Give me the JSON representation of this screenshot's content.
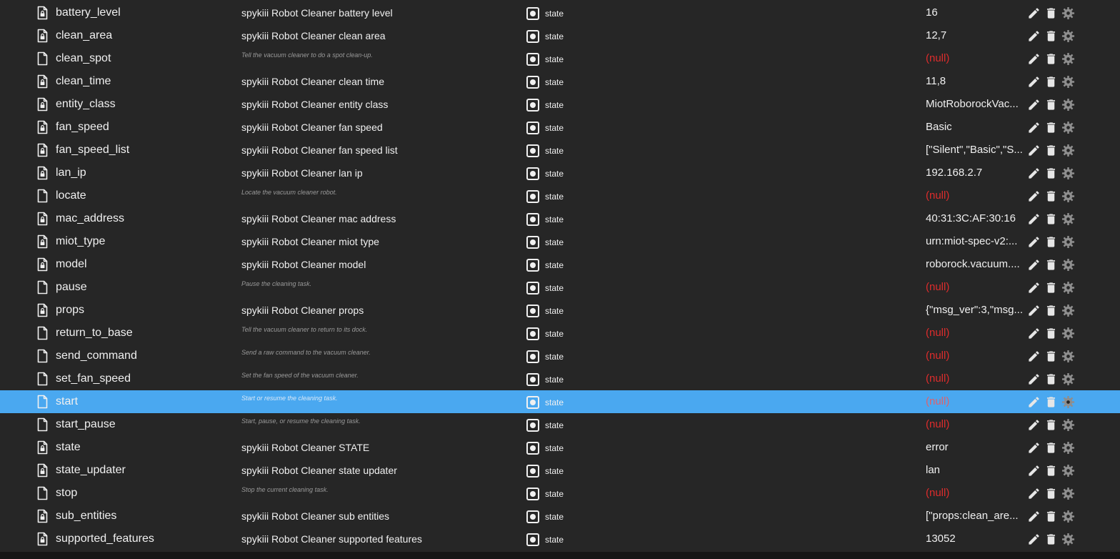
{
  "role_label": "state",
  "icons": {
    "file": "file-icon",
    "role": "state-role-icon",
    "edit": "pencil-icon",
    "delete": "trash-icon",
    "settings": "gear-icon"
  },
  "colors": {
    "background": "#262626",
    "selected_row": "#4aa8f0",
    "null_value": "#dd2c2c",
    "text": "#f0f0f0",
    "hint_text": "#9a9a9a"
  },
  "selected_row": "start",
  "rows": [
    {
      "name": "battery_level",
      "description": "spykiii Robot Cleaner battery level",
      "value": "16",
      "locked": true
    },
    {
      "name": "clean_area",
      "description": "spykiii Robot Cleaner clean area",
      "value": "12,7",
      "locked": true
    },
    {
      "name": "clean_spot",
      "hint": "Tell the vacuum cleaner to do a spot clean-up.",
      "value": "(null)",
      "locked": false
    },
    {
      "name": "clean_time",
      "description": "spykiii Robot Cleaner clean time",
      "value": "11,8",
      "locked": true
    },
    {
      "name": "entity_class",
      "description": "spykiii Robot Cleaner entity class",
      "value": "MiotRoborockVac...",
      "locked": true
    },
    {
      "name": "fan_speed",
      "description": "spykiii Robot Cleaner fan speed",
      "value": "Basic",
      "locked": true
    },
    {
      "name": "fan_speed_list",
      "description": "spykiii Robot Cleaner fan speed list",
      "value": "[\"Silent\",\"Basic\",\"S...",
      "locked": true
    },
    {
      "name": "lan_ip",
      "description": "spykiii Robot Cleaner lan ip",
      "value": "192.168.2.7",
      "locked": true
    },
    {
      "name": "locate",
      "hint": "Locate the vacuum cleaner robot.",
      "value": "(null)",
      "locked": false
    },
    {
      "name": "mac_address",
      "description": "spykiii Robot Cleaner mac address",
      "value": "40:31:3C:AF:30:16",
      "locked": true
    },
    {
      "name": "miot_type",
      "description": "spykiii Robot Cleaner miot type",
      "value": "urn:miot-spec-v2:...",
      "locked": true
    },
    {
      "name": "model",
      "description": "spykiii Robot Cleaner model",
      "value": "roborock.vacuum....",
      "locked": true
    },
    {
      "name": "pause",
      "hint": "Pause the cleaning task.",
      "value": "(null)",
      "locked": false
    },
    {
      "name": "props",
      "description": "spykiii Robot Cleaner props",
      "value": "{\"msg_ver\":3,\"msg...",
      "locked": true
    },
    {
      "name": "return_to_base",
      "hint": "Tell the vacuum cleaner to return to its dock.",
      "value": "(null)",
      "locked": false
    },
    {
      "name": "send_command",
      "hint": "Send a raw command to the vacuum cleaner.",
      "value": "(null)",
      "locked": false
    },
    {
      "name": "set_fan_speed",
      "hint": "Set the fan speed of the vacuum cleaner.",
      "value": "(null)",
      "locked": false
    },
    {
      "name": "start",
      "hint": "Start or resume the cleaning task.",
      "value": "(null)",
      "locked": false
    },
    {
      "name": "start_pause",
      "hint": "Start, pause, or resume the cleaning task.",
      "value": "(null)",
      "locked": false
    },
    {
      "name": "state",
      "description": "spykiii Robot Cleaner STATE",
      "value": "error",
      "locked": true
    },
    {
      "name": "state_updater",
      "description": "spykiii Robot Cleaner state updater",
      "value": "lan",
      "locked": true
    },
    {
      "name": "stop",
      "hint": "Stop the current cleaning task.",
      "value": "(null)",
      "locked": false
    },
    {
      "name": "sub_entities",
      "description": "spykiii Robot Cleaner sub entities",
      "value": "[\"props:clean_are...",
      "locked": true
    },
    {
      "name": "supported_features",
      "description": "spykiii Robot Cleaner supported features",
      "value": "13052",
      "locked": true
    }
  ]
}
